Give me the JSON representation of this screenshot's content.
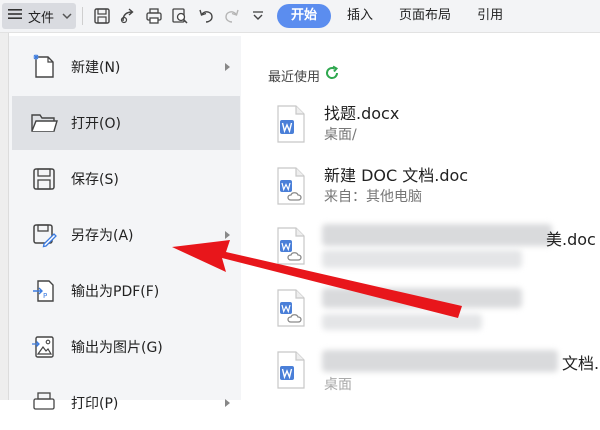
{
  "toolbar": {
    "file_label": "文件",
    "tabs": [
      {
        "label": "开始",
        "active": true
      },
      {
        "label": "插入",
        "active": false
      },
      {
        "label": "页面布局",
        "active": false
      },
      {
        "label": "引用",
        "active": false
      }
    ],
    "icons": [
      "hamburger-icon",
      "chevron-down-icon",
      "save-icon",
      "export-icon",
      "print-icon",
      "print-preview-icon",
      "undo-icon",
      "redo-icon",
      "more-dropdown-icon"
    ]
  },
  "menu": {
    "items": [
      {
        "label": "新建(N)",
        "icon": "new-doc-icon",
        "submenu": true
      },
      {
        "label": "打开(O)",
        "icon": "folder-icon",
        "submenu": false,
        "hovered": true
      },
      {
        "label": "保存(S)",
        "icon": "save-icon",
        "submenu": false
      },
      {
        "label": "另存为(A)",
        "icon": "save-as-icon",
        "submenu": true
      },
      {
        "label": "输出为PDF(F)",
        "icon": "pdf-export-icon",
        "submenu": false
      },
      {
        "label": "输出为图片(G)",
        "icon": "image-export-icon",
        "submenu": false
      },
      {
        "label": "打印(P)",
        "icon": "print-icon",
        "submenu": true
      }
    ]
  },
  "recent": {
    "title": "最近使用",
    "title_icon": "refresh-icon",
    "docs": [
      {
        "name": "找题.docx",
        "location": "桌面/",
        "icon": "word-doc-icon"
      },
      {
        "name": "新建 DOC 文档.doc",
        "location": "来自：其他电脑",
        "icon": "word-cloud-doc-icon"
      },
      {
        "name_tail": "美.doc",
        "icon": "word-cloud-doc-icon"
      },
      {
        "icon": "word-cloud-doc-icon"
      },
      {
        "name_tail": "文档.",
        "location": "桌面",
        "icon": "word-doc-icon"
      }
    ]
  },
  "colors": {
    "accent": "#5b8def",
    "arrow": "#e8161b",
    "word_blue": "#4a7fd8"
  }
}
